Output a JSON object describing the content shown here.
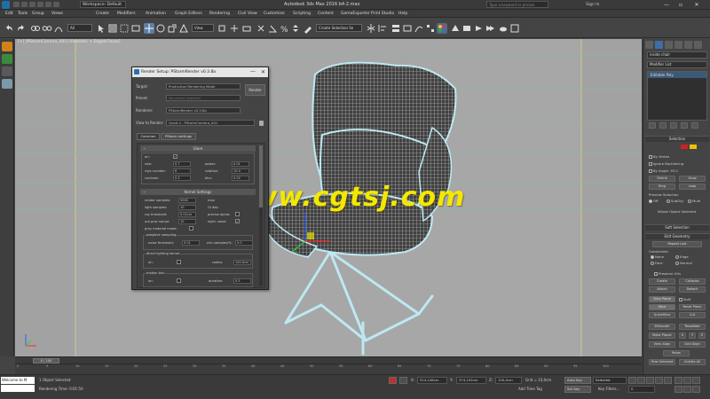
{
  "titlebar": {
    "workspace": "Workspace: Default",
    "title": "Autodesk 3ds Max 2016     b4-2.max",
    "search_placeholder": "Type a keyword or phrase",
    "signin": "Sign In",
    "minimize": "—",
    "maximize": "▫",
    "close": "✕"
  },
  "menubar": {
    "items": [
      "Edit",
      "Tools",
      "Group",
      "Views",
      "Create",
      "Modifiers",
      "Animation",
      "Graph Editors",
      "Rendering",
      "Civil View",
      "Customize",
      "Scripting",
      "Content",
      "GameExporter",
      "Print Studio",
      "Help"
    ]
  },
  "toolbar": {
    "view_dropdown": "View",
    "selection_set_dropdown": "Create Selection Se"
  },
  "viewport": {
    "label": "[+] [PStormCamera_001] [Realistic + Edged Faces]"
  },
  "command_panel": {
    "object_name": "inside chair",
    "modifier_list": "Modifier List",
    "stack_item": "Editable Poly",
    "selection_title": "Selection",
    "by_vertex": "By Vertex",
    "ignore_backfacing": "Ignore Backfacing",
    "by_angle": "By Angle:",
    "by_angle_value": "45.0",
    "shrink": "Shrink",
    "grow": "Grow",
    "ring": "Ring",
    "loop": "Loop",
    "preview_selection": "Preview Selection",
    "off": "Off",
    "subobj": "SubObj",
    "multi": "Multi",
    "whole_object_selected": "Whole Object Selected",
    "soft_selection": "Soft Selection",
    "edit_geometry": "Edit Geometry",
    "repeat_last": "Repeat Last",
    "constraints": "Constraints",
    "none": "None",
    "edge": "Edge",
    "face": "Face",
    "normal": "Normal",
    "preserve_uvs": "Preserve UVs",
    "create": "Create",
    "collapse": "Collapse",
    "attach": "Attach",
    "detach": "Detach",
    "slice_plane": "Slice Plane",
    "split": "Split",
    "slice": "Slice",
    "reset_plane": "Reset Plane",
    "quickslice": "QuickSlice",
    "cut": "Cut",
    "msmooth": "MSmooth",
    "tessellate": "Tessellate",
    "make_planar": "Make Planar",
    "x": "X",
    "y": "Y",
    "z": "Z",
    "view_align": "View Align",
    "grid_align": "Grid Align",
    "relax": "Relax",
    "hide_selected": "Hide Selected",
    "unhide_all": "Unhide All",
    "colors": {
      "swatch_red": "#d02020",
      "swatch_yellow": "#f0c000"
    }
  },
  "render_dialog": {
    "title": "Render Setup: PStormRender v0.3.8a",
    "minimize": "—",
    "close": "✕",
    "target_label": "Target:",
    "target_value": "Production Rendering Mode",
    "preset_label": "Preset:",
    "preset_value": "No preset selected",
    "renderer_label": "Renderer:",
    "renderer_value": "PStormRender v0.3.8a",
    "view_label": "View to Render:",
    "view_value": "Quad 4 - PStormCamera_001",
    "render_button": "Render",
    "tabs": [
      "Common",
      "PStorm settings"
    ],
    "glare": {
      "title": "Glare",
      "on": "on:",
      "size": "size:",
      "size_value": "0.7",
      "power": "power:",
      "power_value": "0.01",
      "rays_number": "rays number:",
      "rays_value": "6",
      "rotation": "rotation:",
      "rotation_value": "10.0",
      "contrast": "contrast:",
      "contrast_value": "0.5",
      "blur": "blur:",
      "blur_value": "0.02"
    },
    "kernel": {
      "title": "Kernel Settings",
      "render_samples": "render samples:",
      "render_samples_value": "5000",
      "max": "max",
      "light_samples": "light samples:",
      "light_samples_value": "10",
      "gi_depth": "GI dep",
      "ray_threshold": "ray threshold:",
      "ray_threshold_value": "0.01cm",
      "precise_alpha": "precise alpha:",
      "out_prec_sampl": "out prec sampl:",
      "out_prec_value": "10",
      "stylic_noise": "stylic noise:",
      "grey_material_mode": "grey material mode:",
      "adaptive_sampling": "adaptive sampling",
      "noise_threshold": "noise threshold:",
      "noise_threshold_value": "0.01",
      "min_samples": "min samples/%:",
      "min_samples_value": "5.0",
      "direct_lighting_kernel": "direct lighting kernel",
      "on": "on:",
      "radius": "radius:",
      "radius_value": "100.0cm",
      "motion_blur": "motion blur",
      "duration": "duration:",
      "duration_value": "0.5"
    }
  },
  "watermark": "www.cgtsj.com",
  "timeline": {
    "frame": "0 / 100",
    "ticks": [
      "0",
      "5",
      "10",
      "15",
      "20",
      "25",
      "30",
      "35",
      "40",
      "45",
      "50",
      "55",
      "60",
      "65",
      "70",
      "75",
      "80",
      "85",
      "90",
      "95",
      "100"
    ]
  },
  "statusbar": {
    "maxscript": "Welcome to M",
    "selection_info": "1 Object Selected",
    "render_time": "Rendering Time: 0:01:50",
    "x_label": "X:",
    "x_value": "514,146cm",
    "y_label": "Y:",
    "y_value": "374,105cm",
    "z_label": "Z:",
    "z_value": "100,0cm",
    "grid": "Grid = 10,0cm",
    "add_time_tag": "Add Time Tag",
    "auto_key": "Auto Key",
    "set_key": "Set Key",
    "selected": "Selected",
    "key_filters": "Key Filters...",
    "frame_value": "0"
  }
}
